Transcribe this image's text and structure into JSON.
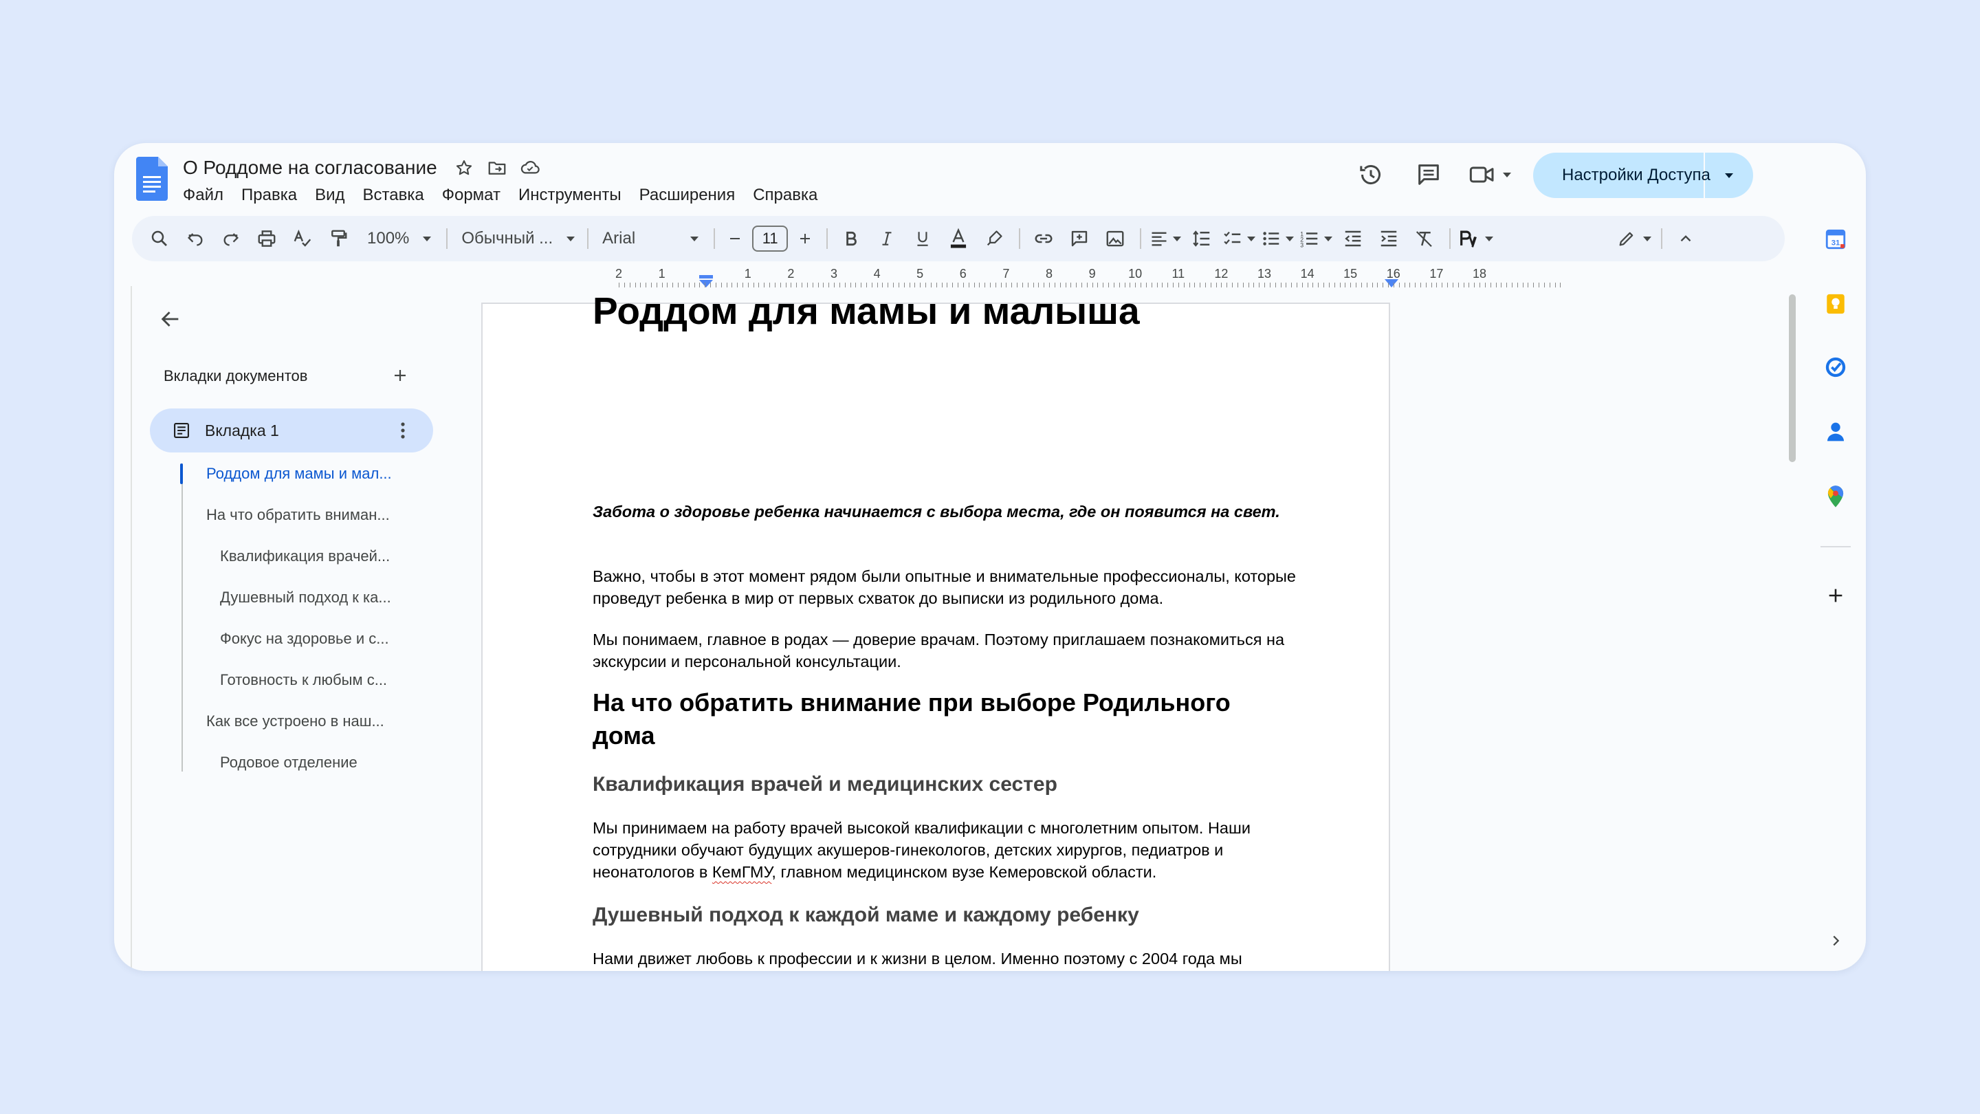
{
  "header": {
    "title": "О Роддоме на согласование",
    "menu": [
      "Файл",
      "Правка",
      "Вид",
      "Вставка",
      "Формат",
      "Инструменты",
      "Расширения",
      "Справка"
    ],
    "share_label": "Настройки Доступа"
  },
  "toolbar": {
    "zoom": "100%",
    "style": "Обычный ...",
    "font": "Arial",
    "font_size": "11"
  },
  "ruler": {
    "numbers": [
      "2",
      "1",
      "1",
      "2",
      "3",
      "4",
      "5",
      "6",
      "7",
      "8",
      "9",
      "10",
      "11",
      "12",
      "13",
      "14",
      "15",
      "16",
      "17",
      "18"
    ]
  },
  "sidebar": {
    "header": "Вкладки документов",
    "tab_label": "Вкладка 1",
    "outline": [
      "Роддом для мамы и мал...",
      "На что обратить вниман...",
      "Квалификация врачей...",
      "Душевный подход к ка...",
      "Фокус на здоровье и с...",
      "Готовность к любым с...",
      "Как все устроено в наш...",
      "Родовое отделение"
    ]
  },
  "document": {
    "title": "Роддом для мамы и малыша",
    "subtitle": "Забота о здоровье ребенка начинается с выбора места, где он появится на свет.",
    "para1": "Важно, чтобы в этот момент рядом были опытные и внимательные профессионалы, которые проведут ребенка в мир от первых схваток до выписки из родильного дома.",
    "para2": "Мы понимаем, главное в родах — доверие врачам. Поэтому приглашаем познакомиться на экскурсии и персональной консультации.",
    "heading2": "На что обратить внимание при выборе Родильного дома",
    "heading3_1": "Квалификация врачей и медицинских сестер",
    "para3_before": "Мы принимаем на работу врачей высокой квалификации с многолетним опытом. Наши сотрудники обучают будущих акушеров-гинекологов, детских хирургов, педиатров и неонатологов в ",
    "para3_link": "КемГМУ",
    "para3_after": ", главном медицинском вузе Кемеровской области.",
    "heading3_2": "Душевный подход к каждой маме и каждому ребенку",
    "para4": "Нами движет любовь к профессии и к жизни в целом. Именно поэтому с 2004 года мы"
  },
  "colors": {
    "background": "#dee9fc",
    "accent": "#0b57d0",
    "share_button": "#c2e7ff",
    "active_tab": "#d3e3fd"
  }
}
